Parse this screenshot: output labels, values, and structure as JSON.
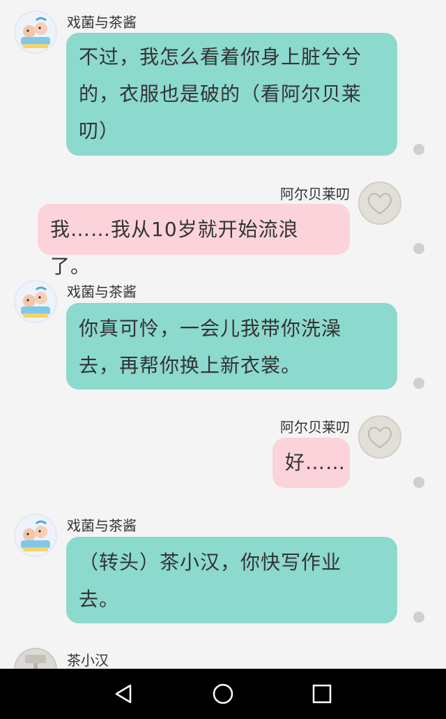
{
  "messages": [
    {
      "sender": "戏菌与茶酱",
      "side": "left",
      "color": "teal",
      "lines": [
        "不过，我怎么看着你身上脏兮兮",
        "的，衣服也是破的（看阿尔贝莱",
        "叨）"
      ]
    },
    {
      "sender": "阿尔贝莱叨",
      "side": "right",
      "color": "pink",
      "lines": [
        "我……我从10岁就开始流浪了。"
      ]
    },
    {
      "sender": "戏菌与茶酱",
      "side": "left",
      "color": "teal",
      "lines": [
        "你真可怜，一会儿我带你洗澡",
        "去，再帮你换上新衣裳。"
      ]
    },
    {
      "sender": "阿尔贝莱叨",
      "side": "right",
      "color": "pink",
      "lines": [
        "好……"
      ]
    },
    {
      "sender": "戏菌与茶酱",
      "side": "left",
      "color": "teal",
      "lines": [
        "（转头）茶小汉，你快写作业",
        "去。"
      ]
    },
    {
      "sender": "茶小汉",
      "side": "left",
      "color": "",
      "lines": []
    }
  ],
  "colors": {
    "teal": "#8cd9ce",
    "pink": "#fcd3da",
    "background": "#f4f4f4",
    "navbar": "#000000"
  },
  "icons": {
    "avatar_xijun": "cartoon-sticker-avatar",
    "avatar_aerbei": "heart-outline-avatar",
    "avatar_chaxiaohan": "hammer-avatar",
    "nav_back": "triangle-back-icon",
    "nav_home": "circle-home-icon",
    "nav_recent": "square-recent-icon"
  }
}
